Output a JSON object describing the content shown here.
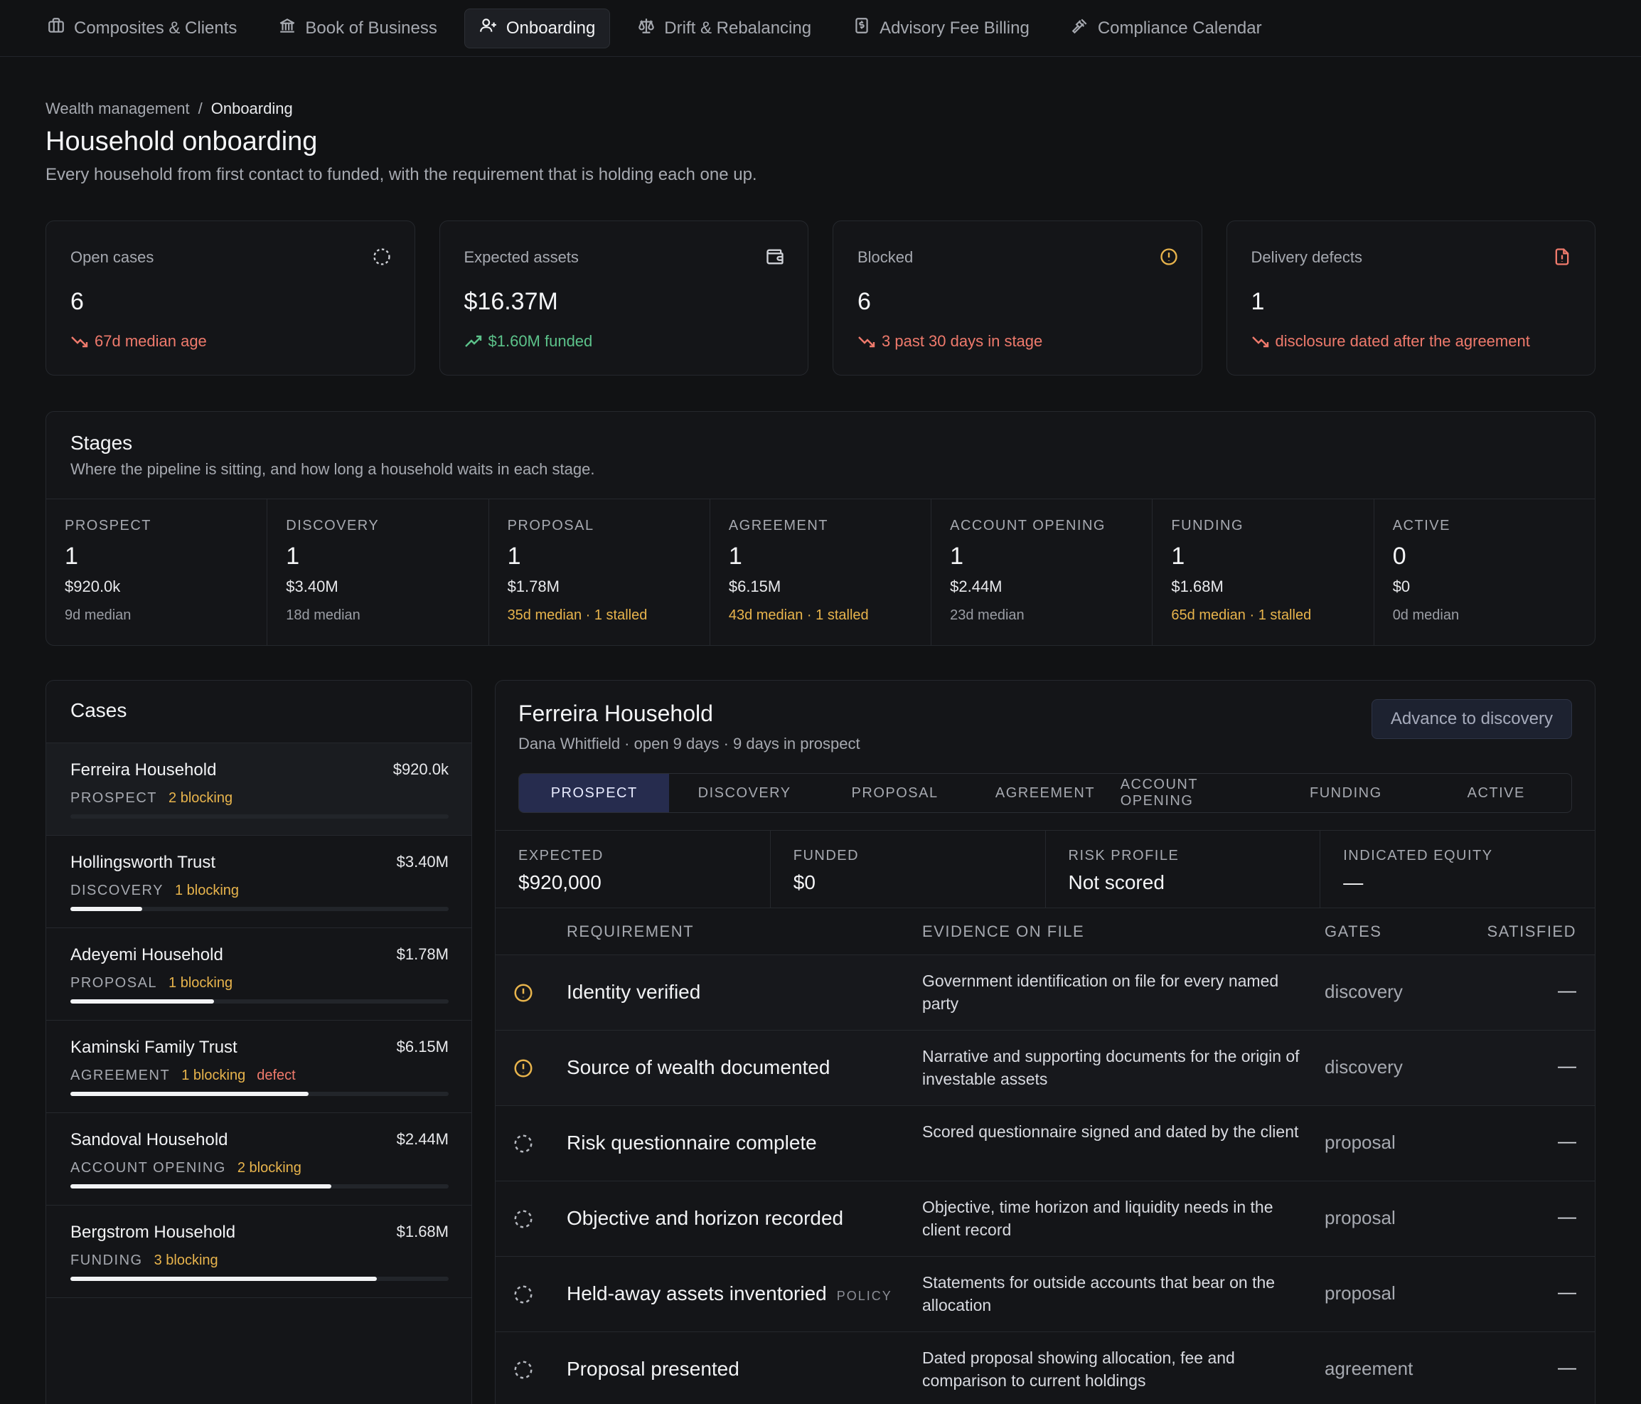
{
  "nav": {
    "tabs": [
      {
        "label": "Composites & Clients",
        "icon": "briefcase-icon"
      },
      {
        "label": "Book of Business",
        "icon": "bank-icon"
      },
      {
        "label": "Onboarding",
        "icon": "user-plus-icon",
        "active": true
      },
      {
        "label": "Drift & Rebalancing",
        "icon": "scale-icon"
      },
      {
        "label": "Advisory Fee Billing",
        "icon": "receipt-icon"
      },
      {
        "label": "Compliance Calendar",
        "icon": "gavel-icon"
      }
    ]
  },
  "breadcrumb": {
    "root": "Wealth management",
    "sep": "/",
    "current": "Onboarding"
  },
  "header": {
    "title": "Household onboarding",
    "subtitle": "Every household from first contact to funded, with the requirement that is holding each one up."
  },
  "stats": [
    {
      "label": "Open cases",
      "value": "6",
      "trend": "67d median age",
      "trend_dir": "down",
      "tone": "red",
      "icon": "loading-circle-icon"
    },
    {
      "label": "Expected assets",
      "value": "$16.37M",
      "trend": "$1.60M funded",
      "trend_dir": "up",
      "tone": "green",
      "icon": "wallet-icon"
    },
    {
      "label": "Blocked",
      "value": "6",
      "trend": "3 past 30 days in stage",
      "trend_dir": "down",
      "tone": "red",
      "icon": "alert-circle-icon"
    },
    {
      "label": "Delivery defects",
      "value": "1",
      "trend": "disclosure dated after the agreement",
      "trend_dir": "down",
      "tone": "red",
      "icon": "file-alert-icon"
    }
  ],
  "stages": {
    "title": "Stages",
    "subtitle": "Where the pipeline is sitting, and how long a household waits in each stage.",
    "items": [
      {
        "name": "PROSPECT",
        "count": "1",
        "amount": "$920.0k",
        "median": "9d median",
        "stalled": false
      },
      {
        "name": "DISCOVERY",
        "count": "1",
        "amount": "$3.40M",
        "median": "18d median",
        "stalled": false
      },
      {
        "name": "PROPOSAL",
        "count": "1",
        "amount": "$1.78M",
        "median": "35d median · 1 stalled",
        "stalled": true
      },
      {
        "name": "AGREEMENT",
        "count": "1",
        "amount": "$6.15M",
        "median": "43d median · 1 stalled",
        "stalled": true
      },
      {
        "name": "ACCOUNT OPENING",
        "count": "1",
        "amount": "$2.44M",
        "median": "23d median",
        "stalled": false
      },
      {
        "name": "FUNDING",
        "count": "1",
        "amount": "$1.68M",
        "median": "65d median · 1 stalled",
        "stalled": true
      },
      {
        "name": "ACTIVE",
        "count": "0",
        "amount": "$0",
        "median": "0d median",
        "stalled": false
      }
    ]
  },
  "cases": {
    "title": "Cases",
    "items": [
      {
        "name": "Ferreira Household",
        "amount": "$920.0k",
        "stage": "PROSPECT",
        "blocking": "2 blocking",
        "defect": "",
        "progress": 0,
        "selected": true
      },
      {
        "name": "Hollingsworth Trust",
        "amount": "$3.40M",
        "stage": "DISCOVERY",
        "blocking": "1 blocking",
        "defect": "",
        "progress": 0.19
      },
      {
        "name": "Adeyemi Household",
        "amount": "$1.78M",
        "stage": "PROPOSAL",
        "blocking": "1 blocking",
        "defect": "",
        "progress": 0.38
      },
      {
        "name": "Kaminski Family Trust",
        "amount": "$6.15M",
        "stage": "AGREEMENT",
        "blocking": "1 blocking",
        "defect": "defect",
        "progress": 0.63
      },
      {
        "name": "Sandoval Household",
        "amount": "$2.44M",
        "stage": "ACCOUNT OPENING",
        "blocking": "2 blocking",
        "defect": "",
        "progress": 0.69
      },
      {
        "name": "Bergstrom Household",
        "amount": "$1.68M",
        "stage": "FUNDING",
        "blocking": "3 blocking",
        "defect": "",
        "progress": 0.81
      }
    ]
  },
  "detail": {
    "name": "Ferreira Household",
    "meta": "Dana Whitfield · open 9 days · 9 days in prospect",
    "advance_label": "Advance to discovery",
    "steps": [
      "PROSPECT",
      "DISCOVERY",
      "PROPOSAL",
      "AGREEMENT",
      "ACCOUNT OPENING",
      "FUNDING",
      "ACTIVE"
    ],
    "active_step": 0,
    "facts": [
      {
        "k": "EXPECTED",
        "v": "$920,000"
      },
      {
        "k": "FUNDED",
        "v": "$0"
      },
      {
        "k": "RISK PROFILE",
        "v": "Not scored"
      },
      {
        "k": "INDICATED EQUITY",
        "v": "—"
      }
    ],
    "columns": {
      "requirement": "REQUIREMENT",
      "evidence": "EVIDENCE ON FILE",
      "gates": "GATES",
      "satisfied": "SATISFIED"
    },
    "requirements": [
      {
        "name": "Identity verified",
        "tag": "",
        "evidence": "Government identification on file for every named party",
        "gate": "discovery",
        "satisfied": "—",
        "status": "blocking"
      },
      {
        "name": "Source of wealth documented",
        "tag": "",
        "evidence": "Narrative and supporting documents for the origin of investable assets",
        "gate": "discovery",
        "satisfied": "—",
        "status": "blocking"
      },
      {
        "name": "Risk questionnaire complete",
        "tag": "",
        "evidence": "Scored questionnaire signed and dated by the client",
        "gate": "proposal",
        "satisfied": "—",
        "status": "pending"
      },
      {
        "name": "Objective and horizon recorded",
        "tag": "",
        "evidence": "Objective, time horizon and liquidity needs in the client record",
        "gate": "proposal",
        "satisfied": "—",
        "status": "pending"
      },
      {
        "name": "Held-away assets inventoried",
        "tag": "POLICY",
        "evidence": "Statements for outside accounts that bear on the allocation",
        "gate": "proposal",
        "satisfied": "—",
        "status": "pending"
      },
      {
        "name": "Proposal presented",
        "tag": "",
        "evidence": "Dated proposal showing allocation, fee and comparison to current holdings",
        "gate": "agreement",
        "satisfied": "—",
        "status": "pending"
      }
    ]
  },
  "colors": {
    "amber": "#e8b44c",
    "red": "#ef7a6c",
    "green": "#5cc28a",
    "accent": "#262c4e"
  }
}
